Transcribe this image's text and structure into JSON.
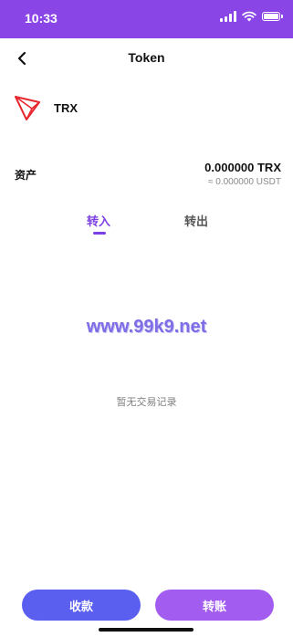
{
  "status_bar": {
    "time": "10:33"
  },
  "nav": {
    "title": "Token"
  },
  "token": {
    "symbol": "TRX"
  },
  "asset": {
    "label": "资产",
    "amount": "0.000000 TRX",
    "usdt": "≈ 0.000000 USDT"
  },
  "tabs": [
    {
      "label": "转入",
      "active": true
    },
    {
      "label": "转出",
      "active": false
    }
  ],
  "watermark": "www.99k9.net",
  "empty_text": "暂无交易记录",
  "actions": {
    "receive": "收款",
    "transfer": "转账"
  },
  "colors": {
    "accent": "#8a45e6",
    "tron_red": "#e8262d",
    "receive_button": "#5a5ff0",
    "transfer_button": "#a35cf0"
  }
}
